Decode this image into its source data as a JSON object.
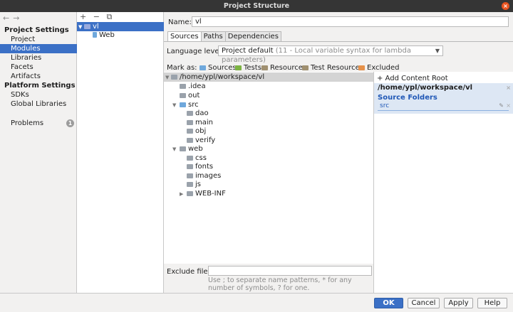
{
  "window": {
    "title": "Project Structure"
  },
  "nav": {
    "project_settings": "Project Settings",
    "project_items": [
      "Project",
      "Modules",
      "Libraries",
      "Facets",
      "Artifacts"
    ],
    "platform_settings": "Platform Settings",
    "platform_items": [
      "SDKs",
      "Global Libraries"
    ],
    "problems": "Problems",
    "problems_count": "1"
  },
  "modules": {
    "tool_add": "+",
    "tool_remove": "−",
    "tool_copy": "⧉",
    "items": [
      "vl",
      "Web"
    ]
  },
  "name": {
    "label": "Name:",
    "value": "vl"
  },
  "tabs": [
    "Sources",
    "Paths",
    "Dependencies"
  ],
  "language": {
    "label": "Language level:",
    "value": "Project default",
    "hint": "(11 - Local variable syntax for lambda parameters)"
  },
  "mark_as": {
    "label": "Mark as:",
    "items": [
      "Sources",
      "Tests",
      "Resources",
      "Test Resources",
      "Excluded"
    ]
  },
  "tree": {
    "root": "/home/ypl/workspace/vl",
    "nodes": [
      ".idea",
      "out",
      "src",
      "dao",
      "main",
      "obj",
      "verify",
      "web",
      "css",
      "fonts",
      "images",
      "js",
      "WEB-INF"
    ]
  },
  "content_root": {
    "add": "+ Add Content Root",
    "path": "/home/ypl/workspace/vl",
    "source_header": "Source Folders",
    "source_item": "src"
  },
  "exclude": {
    "label": "Exclude files:",
    "hint": "Use ; to separate name patterns, * for any number of symbols, ? for one."
  },
  "buttons": {
    "ok": "OK",
    "cancel": "Cancel",
    "apply": "Apply",
    "help": "Help"
  },
  "colors": {
    "accent": "#3b70c6",
    "source_folder": "#6fa8dc",
    "tests": "#7cb342",
    "excluded": "#e6914a"
  }
}
